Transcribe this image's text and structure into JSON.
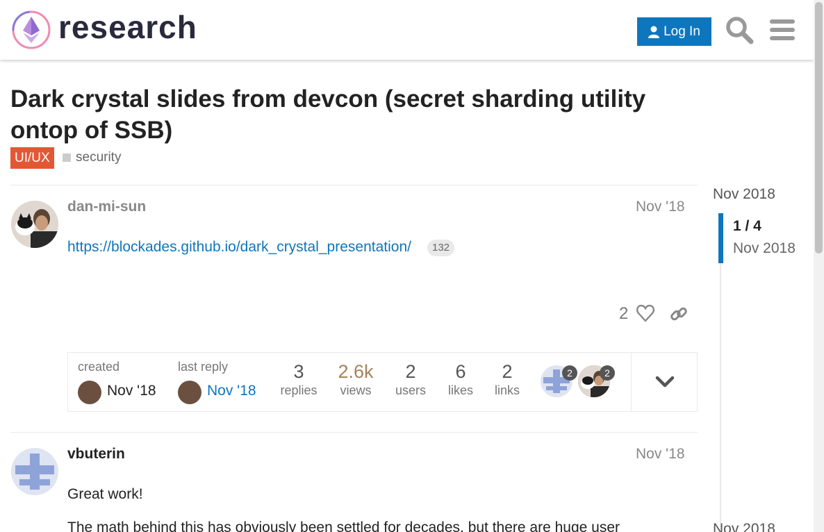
{
  "header": {
    "logo_text": "research",
    "login_label": "Log In"
  },
  "topic": {
    "title": "Dark crystal slides from devcon (secret sharding utility ontop of SSB)",
    "category": "UI/UX",
    "category_color": "#e45735",
    "tag": "security"
  },
  "posts": [
    {
      "username": "dan-mi-sun",
      "date": "Nov '18",
      "link": "https://blockades.github.io/dark_crystal_presentation/",
      "link_clicks": "132",
      "likes": "2"
    },
    {
      "username": "vbuterin",
      "date": "Nov '18",
      "body_1": "Great work!",
      "body_2": "The math behind this has obviously been settled for decades, but there are huge user"
    }
  ],
  "topic_map": {
    "created_label": "created",
    "created_date": "Nov '18",
    "last_reply_label": "last reply",
    "last_reply_date": "Nov '18",
    "stats": [
      {
        "value": "3",
        "label": "replies"
      },
      {
        "value": "2.6k",
        "label": "views"
      },
      {
        "value": "2",
        "label": "users"
      },
      {
        "value": "6",
        "label": "likes"
      },
      {
        "value": "2",
        "label": "links"
      }
    ],
    "participants": [
      {
        "count": "2"
      },
      {
        "count": "2"
      }
    ]
  },
  "timeline": {
    "start_date": "Nov 2018",
    "position": "1 / 4",
    "current_date": "Nov 2018",
    "end_date": "Nov 2018"
  },
  "colors": {
    "accent": "#0e76bd",
    "views_highlight": "#a5825a"
  }
}
